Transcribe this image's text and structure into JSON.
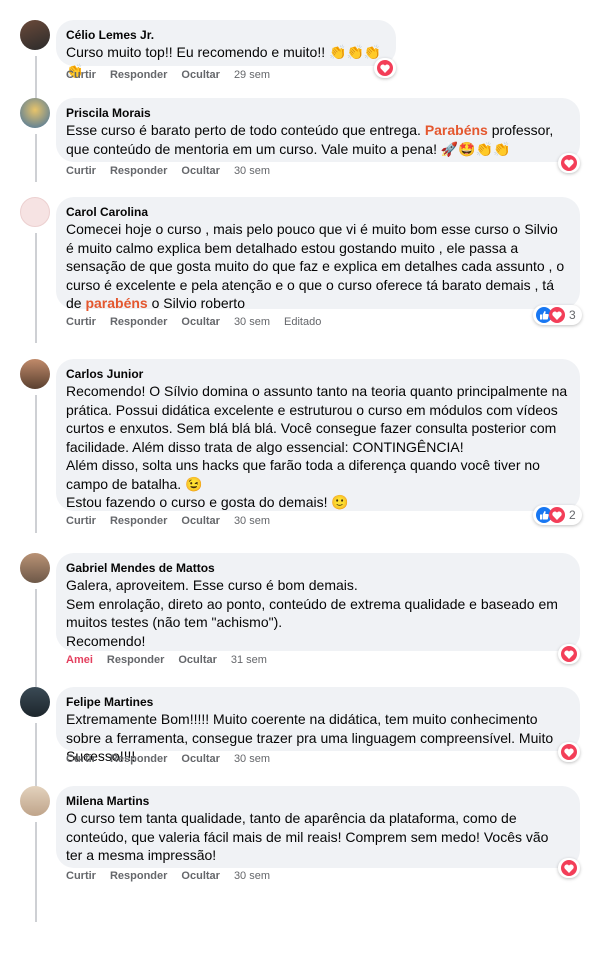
{
  "actions": {
    "like": "Curtir",
    "liked": "Amei",
    "reply": "Responder",
    "hide": "Ocultar",
    "edited": "Editado"
  },
  "comments": [
    {
      "author": "Célio Lemes Jr.",
      "text": "Curso muito top!! Eu recomendo e muito!! 👏👏👏👏",
      "time": "29 sem",
      "reaction_count": ""
    },
    {
      "author": "Priscila Morais",
      "text_before": "Esse curso é barato perto de todo conteúdo que entrega. ",
      "highlight": "Parabéns",
      "text_after": " professor, que conteúdo de mentoria em um curso. Vale muito a pena! 🚀🤩👏👏",
      "time": "30 sem",
      "reaction_count": ""
    },
    {
      "author": "Carol Carolina",
      "text_before": "Comecei hoje o curso , mais pelo pouco que vi é muito bom esse curso o Silvio é muito calmo explica bem detalhado estou gostando muito , ele passa a sensação de que gosta muito do que faz e explica em detalhes cada assunto , o curso é excelente e pela atenção e o que o curso oferece tá barato demais , tá de ",
      "highlight": "parabéns",
      "text_after": " o Silvio roberto",
      "time": "30 sem",
      "reaction_count": "3"
    },
    {
      "author": "Carlos Junior",
      "text": "Recomendo! O Sílvio domina o assunto tanto na teoria quanto principalmente na prática. Possui didática excelente e estruturou o curso em módulos com vídeos curtos e enxutos. Sem blá blá blá. Você consegue fazer consulta posterior com facilidade. Além disso trata de algo essencial: CONTINGÊNCIA!\nAlém disso, solta uns hacks que farão toda a diferença quando você tiver no campo de batalha. 😉\nEstou fazendo o curso e gosta do demais! 🙂",
      "time": "30 sem",
      "reaction_count": "2"
    },
    {
      "author": "Gabriel Mendes de Mattos",
      "text": "Galera, aproveitem. Esse curso é bom demais.\nSem enrolação, direto ao ponto, conteúdo de extrema qualidade e baseado em muitos testes (não tem \"achismo\").\nRecomendo!",
      "time": "31 sem",
      "reaction_count": ""
    },
    {
      "author": "Felipe Martines",
      "text": "Extremamente Bom!!!!! Muito coerente na didática, tem muito conhecimento sobre a ferramenta, consegue trazer pra uma linguagem compreensível. Muito Sucesso!!!!",
      "time": "30 sem",
      "reaction_count": ""
    },
    {
      "author": "Milena Martins",
      "text": "O curso tem tanta qualidade, tanto de aparência da plataforma, como de conteúdo, que valeria fácil mais de mil reais! Comprem sem medo! Vocês vão ter a mesma impressão!",
      "time": "30 sem",
      "reaction_count": ""
    }
  ],
  "colors": {
    "bubble": "#f0f2f5",
    "heart": "#f33e58",
    "like": "#1877f2",
    "highlight": "#e4572e",
    "meta": "#65676b"
  },
  "icons": {
    "reaction_heart": "heart-icon",
    "reaction_like": "like-icon"
  }
}
